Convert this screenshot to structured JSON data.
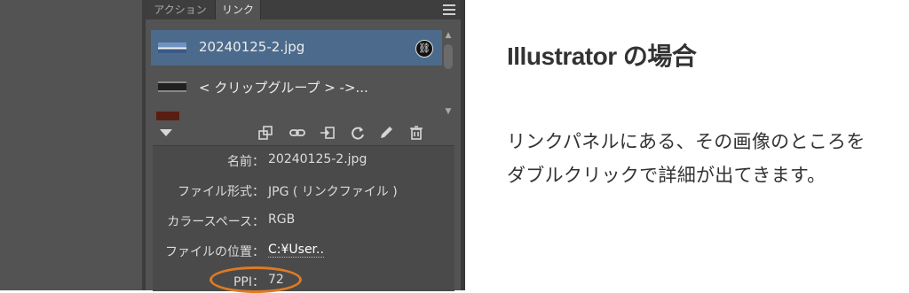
{
  "panel": {
    "tabs": [
      "アクション",
      "リンク"
    ],
    "links": [
      {
        "name": "20240125-2.jpg",
        "thumb": "image-thumbnail",
        "selected": true,
        "has_badge": true
      },
      {
        "name": "< クリップグループ > ->...",
        "thumb": "group-thumbnail"
      },
      {
        "name": "",
        "thumb": "ai-thumbnail"
      }
    ],
    "toolbar_icons": [
      "relink-from-library-icon",
      "relink-icon",
      "go-to-link-icon",
      "update-link-icon",
      "edit-original-icon",
      "delete-icon"
    ],
    "info": {
      "name_label": "名前：",
      "name_value": "20240125-2.jpg",
      "format_label": "ファイル形式：",
      "format_value": "JPG ( リンクファイル )",
      "colorspace_label": "カラースペース：",
      "colorspace_value": "RGB",
      "location_label": "ファイルの位置：",
      "location_value": "C:¥User..",
      "ppi_label": "PPI：",
      "ppi_value": "72"
    },
    "highlight_color": "#e07a22"
  },
  "article": {
    "heading": "Illustrator の場合",
    "line1": "リンクパネルにある、その画像のところを",
    "line2": "ダブルクリックで詳細が出てきます。"
  }
}
